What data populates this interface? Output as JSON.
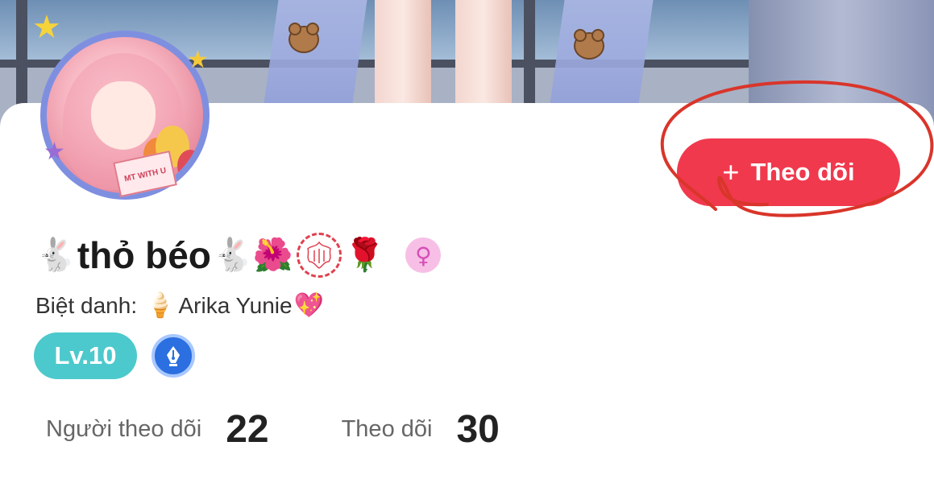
{
  "profile": {
    "name_prefix_emoji": "🐇",
    "name": "thỏ béo",
    "name_suffix_emojis": [
      "🐇",
      "🌺",
      "🌹"
    ],
    "gender_symbol": "♀",
    "nickname_label": "Biệt danh:",
    "nickname_emoji": "🍦",
    "nickname": "Arika Yunie",
    "nickname_suffix_emoji": "💖",
    "level": "Lv.10",
    "avatar_envelope_text": "MT WITH U"
  },
  "follow_button": {
    "icon": "+",
    "label": "Theo dõi"
  },
  "stats": {
    "followers_label": "Người theo dõi",
    "followers_count": "22",
    "following_label": "Theo dõi",
    "following_count": "30"
  },
  "colors": {
    "follow_button": "#f0394d",
    "annotation_circle": "#d9352a",
    "level_badge": "#4cc9cc",
    "avatar_ring": "#7f8fe0",
    "gender_badge": "#f7bfe6"
  },
  "icons": {
    "gender": "female-symbol-icon",
    "level_extra": "fountain-pen-badge-icon"
  }
}
